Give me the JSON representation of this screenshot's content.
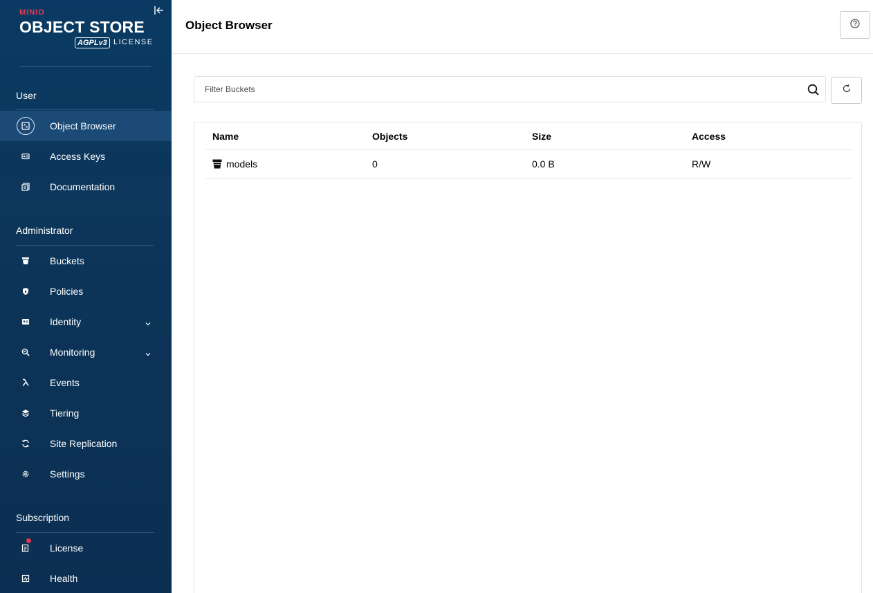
{
  "logo": {
    "brand": "MINIO",
    "product": "OBJECT STORE",
    "agpl": "AGPLv3",
    "license": "LICENSE"
  },
  "sidebar": {
    "sections": [
      {
        "title": "User"
      },
      {
        "title": "Administrator"
      },
      {
        "title": "Subscription"
      }
    ],
    "items": [
      {
        "label": "Object Browser",
        "icon": "object-browser-icon"
      },
      {
        "label": "Access Keys",
        "icon": "access-keys-icon"
      },
      {
        "label": "Documentation",
        "icon": "documentation-icon"
      },
      {
        "label": "Buckets",
        "icon": "bucket-icon"
      },
      {
        "label": "Policies",
        "icon": "policies-icon"
      },
      {
        "label": "Identity",
        "icon": "identity-icon"
      },
      {
        "label": "Monitoring",
        "icon": "monitoring-icon"
      },
      {
        "label": "Events",
        "icon": "lambda-icon"
      },
      {
        "label": "Tiering",
        "icon": "tiering-icon"
      },
      {
        "label": "Site Replication",
        "icon": "site-replication-icon"
      },
      {
        "label": "Settings",
        "icon": "gear-icon"
      },
      {
        "label": "License",
        "icon": "license-icon"
      },
      {
        "label": "Health",
        "icon": "health-icon"
      }
    ]
  },
  "header": {
    "title": "Object Browser"
  },
  "filter": {
    "placeholder": "Filter Buckets"
  },
  "table": {
    "columns": [
      "Name",
      "Objects",
      "Size",
      "Access"
    ],
    "rows": [
      {
        "name": "models",
        "objects": "0",
        "size": "0.0 B",
        "access": "R/W"
      }
    ]
  },
  "colors": {
    "sidebar_bg": "#0c3559",
    "accent_red": "#e33a4f",
    "active_bg": "#1a4a75"
  }
}
